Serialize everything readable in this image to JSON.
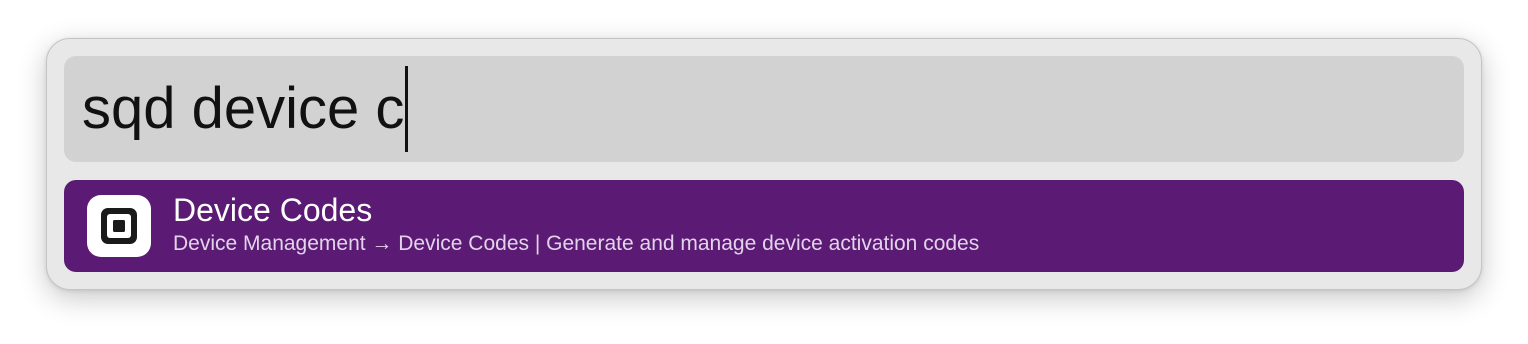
{
  "search": {
    "query": "sqd device c"
  },
  "results": [
    {
      "title": "Device Codes",
      "subtitle": "Device Management → Device Codes | Generate and manage device activation codes",
      "icon": "square-logo-icon",
      "selected": true
    }
  ],
  "colors": {
    "selected_row": "#5b1b74",
    "search_field": "#d2d2d2",
    "panel": "#e8e8e8"
  }
}
